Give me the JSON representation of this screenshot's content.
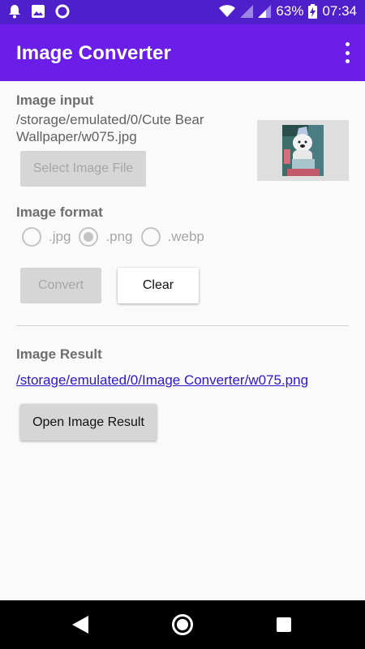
{
  "status_bar": {
    "battery": "63%",
    "time": "07:34"
  },
  "app_bar": {
    "title": "Image Converter"
  },
  "input_section": {
    "label": "Image input",
    "path": "/storage/emulated/0/Cute Bear Wallpaper/w075.jpg",
    "select_button": "Select Image File"
  },
  "format_section": {
    "label": "Image format",
    "options": [
      ".jpg",
      ".png",
      ".webp"
    ],
    "selected": ".png"
  },
  "actions": {
    "convert": "Convert",
    "clear": "Clear"
  },
  "result_section": {
    "label": "Image Result",
    "path": "/storage/emulated/0/Image Converter/w075.png",
    "open_button": "Open Image Result"
  },
  "colors": {
    "status_bar": "#4f1fcc",
    "app_bar": "#6a1ee8",
    "link": "#2b18c8"
  }
}
